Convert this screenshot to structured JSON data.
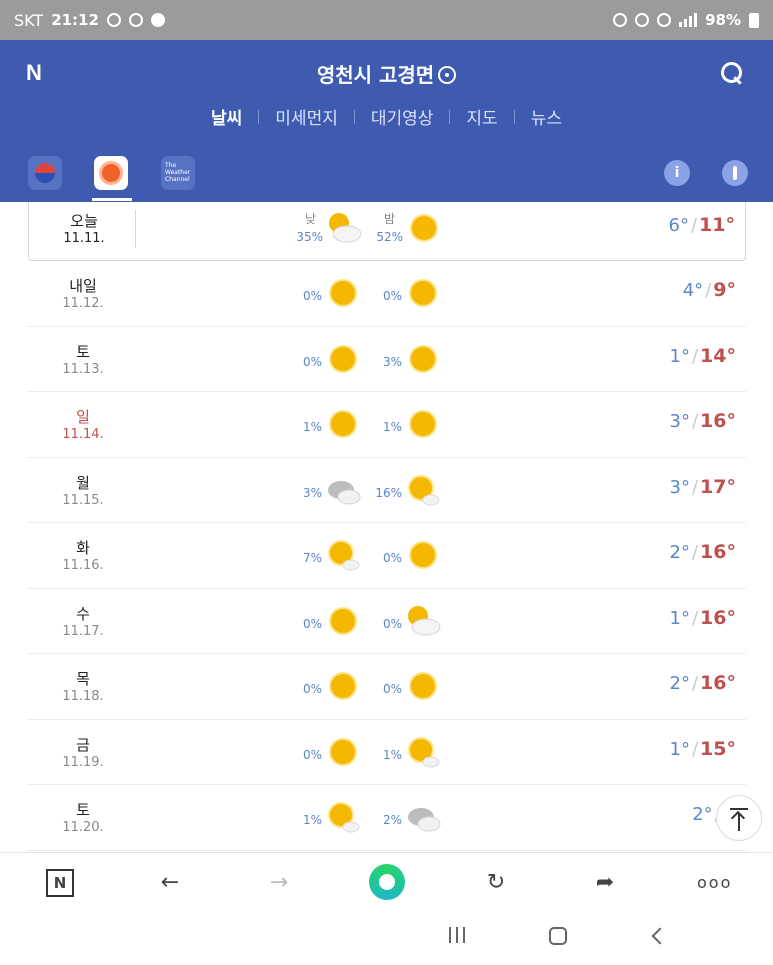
{
  "status_bar": {
    "carrier": "SKT",
    "time": "21:12",
    "battery": "98%"
  },
  "header": {
    "logo": "N",
    "location": "영천시 고경면",
    "tabs": [
      {
        "label": "날씨",
        "active": true
      },
      {
        "label": "미세먼지",
        "active": false
      },
      {
        "label": "대기영상",
        "active": false
      },
      {
        "label": "지도",
        "active": false
      },
      {
        "label": "뉴스",
        "active": false
      }
    ]
  },
  "sources": {
    "twc_label": "The Weather Channel",
    "info_label": "i"
  },
  "labels": {
    "am": "낮",
    "pm": "밤"
  },
  "forecast": [
    {
      "day": "오늘",
      "date": "11.11.",
      "am_pct": "35%",
      "am_icon": "partly-cloudy-icon",
      "pm_pct": "52%",
      "pm_icon": "sun-icon",
      "low": "6°",
      "high": "11°"
    },
    {
      "day": "내일",
      "date": "11.12.",
      "am_pct": "0%",
      "am_icon": "sun-icon",
      "pm_pct": "0%",
      "pm_icon": "sun-icon",
      "low": "4°",
      "high": "9°"
    },
    {
      "day": "토",
      "date": "11.13.",
      "am_pct": "0%",
      "am_icon": "sun-icon",
      "pm_pct": "3%",
      "pm_icon": "sun-icon",
      "low": "1°",
      "high": "14°"
    },
    {
      "day": "일",
      "date": "11.14.",
      "am_pct": "1%",
      "am_icon": "sun-icon",
      "pm_pct": "1%",
      "pm_icon": "sun-icon",
      "low": "3°",
      "high": "16°"
    },
    {
      "day": "월",
      "date": "11.15.",
      "am_pct": "3%",
      "am_icon": "cloudy-icon",
      "pm_pct": "16%",
      "pm_icon": "sun-small-cloud-icon",
      "low": "3°",
      "high": "17°"
    },
    {
      "day": "화",
      "date": "11.16.",
      "am_pct": "7%",
      "am_icon": "sun-small-cloud-icon",
      "pm_pct": "0%",
      "pm_icon": "sun-icon",
      "low": "2°",
      "high": "16°"
    },
    {
      "day": "수",
      "date": "11.17.",
      "am_pct": "0%",
      "am_icon": "sun-icon",
      "pm_pct": "0%",
      "pm_icon": "partly-cloudy-icon",
      "low": "1°",
      "high": "16°"
    },
    {
      "day": "목",
      "date": "11.18.",
      "am_pct": "0%",
      "am_icon": "sun-icon",
      "pm_pct": "0%",
      "pm_icon": "sun-icon",
      "low": "2°",
      "high": "16°"
    },
    {
      "day": "금",
      "date": "11.19.",
      "am_pct": "0%",
      "am_icon": "sun-icon",
      "pm_pct": "1%",
      "pm_icon": "sun-small-cloud-icon",
      "low": "1°",
      "high": "15°"
    },
    {
      "day": "토",
      "date": "11.20.",
      "am_pct": "1%",
      "am_icon": "sun-small-cloud-icon",
      "pm_pct": "2%",
      "pm_icon": "cloudy-icon",
      "low": "2°",
      "high": "1"
    }
  ],
  "colors": {
    "header_bg": "#3e5bb0",
    "low_temp": "#5b86c8",
    "high_temp": "#c0504d",
    "sun": "#f5b800"
  },
  "toolbar": {
    "home_label": "N",
    "back_label": "←",
    "forward_label": "→",
    "reload_label": "↻",
    "share_label": "➦",
    "more_label": "ooo"
  }
}
